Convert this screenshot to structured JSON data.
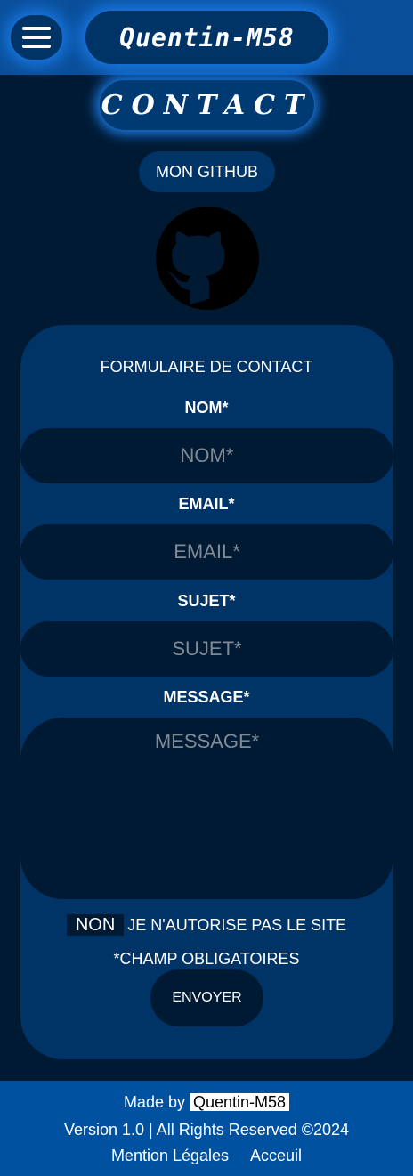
{
  "header": {
    "brand": "Quentin-M58",
    "menu_icon": "hamburger-icon"
  },
  "page": {
    "title": "CONTACT",
    "github_label": "MON  GITHUB",
    "github_icon": "github-icon"
  },
  "form": {
    "title": "FORMULAIRE DE CONTACT",
    "name_label": "NOM*",
    "name_placeholder": "NOM*",
    "email_label": "EMAIL*",
    "email_placeholder": "EMAIL*",
    "subject_label": "SUJET*",
    "subject_placeholder": "SUJET*",
    "message_label": "MESSAGE*",
    "message_placeholder": "MESSAGE*",
    "consent_toggle": "NON",
    "consent_text": "JE N'AUTORISE PAS LE SITE",
    "required_note": "*CHAMP OBLIGATOIRES",
    "submit": "ENVOYER"
  },
  "footer": {
    "made_by": "Made by",
    "author": "Quentin-M58",
    "version": "Version 1.0 | All Rights Reserved ©2024",
    "link_legal": "Mention Légales",
    "link_home": "Acceuil"
  },
  "colors": {
    "background": "#001a33",
    "header": "#0a4f9a",
    "card": "#003366",
    "footer": "#0051a0"
  }
}
